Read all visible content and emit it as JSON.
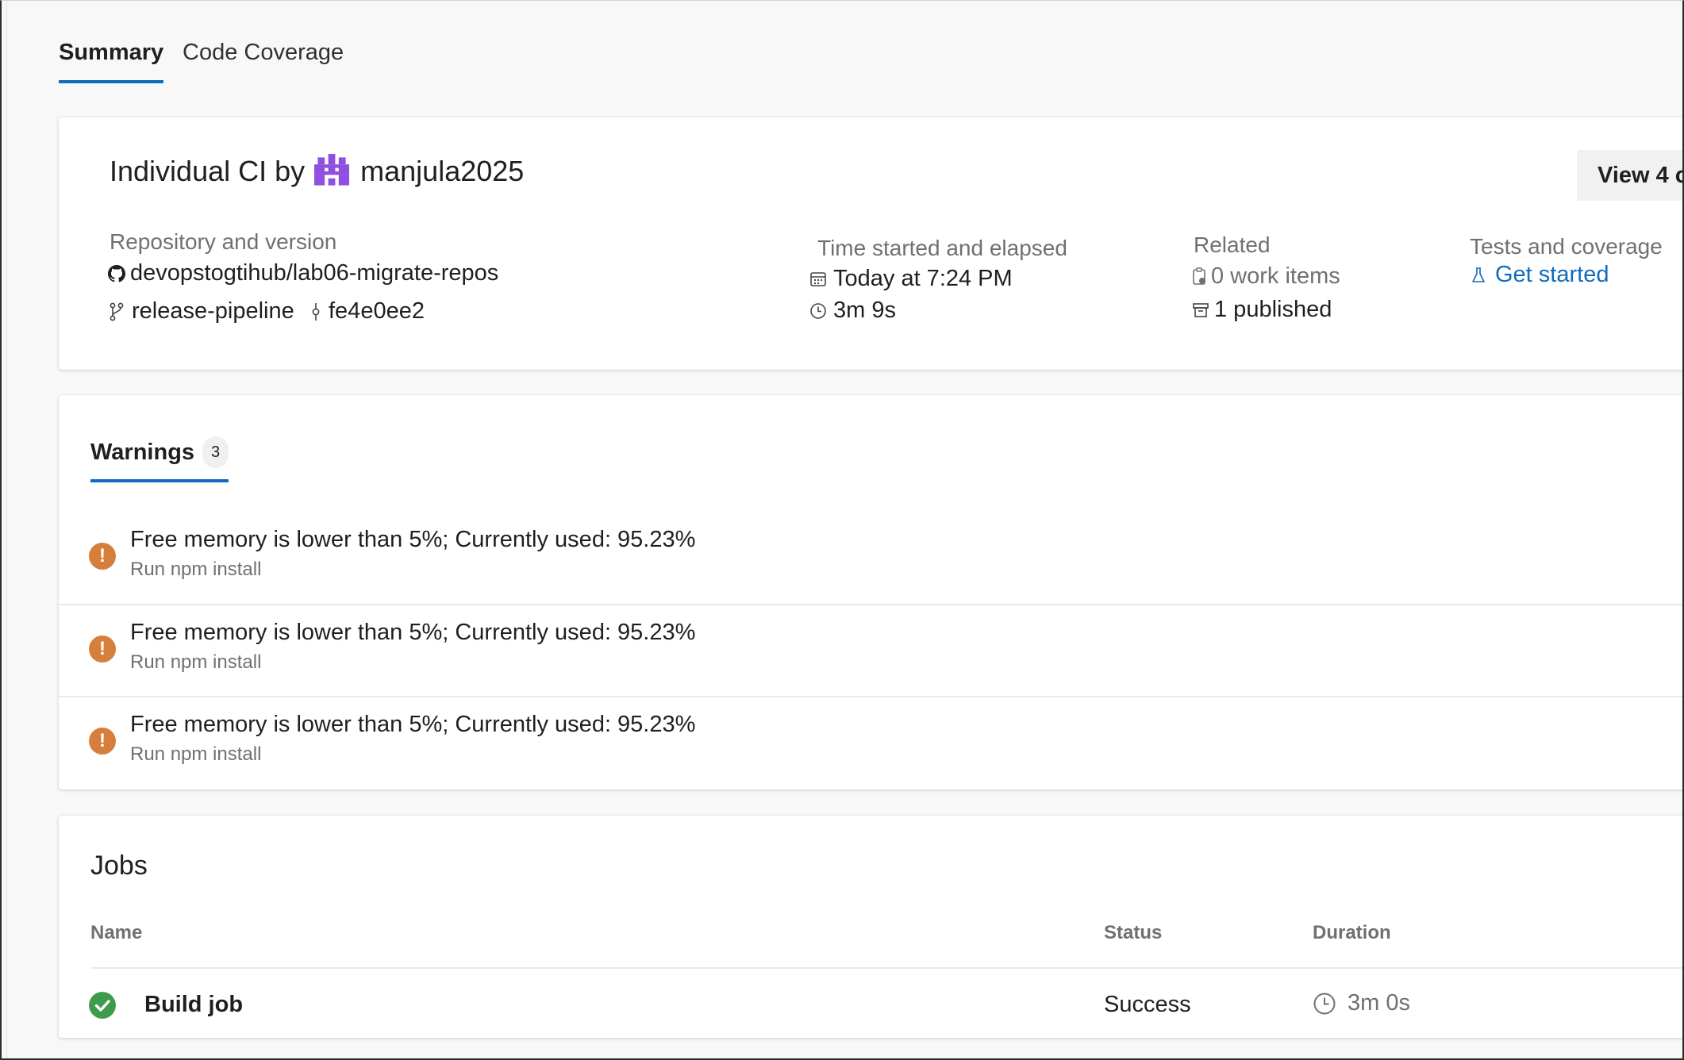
{
  "tabs": [
    {
      "label": "Summary",
      "active": true
    },
    {
      "label": "Code Coverage",
      "active": false
    }
  ],
  "summary": {
    "title_prefix": "Individual CI by",
    "user": "manjula2025",
    "view_button": "View 4 c",
    "repo": {
      "label": "Repository and version",
      "name": "devopstogtihub/lab06-migrate-repos",
      "branch": "release-pipeline",
      "commit": "fe4e0ee2"
    },
    "time": {
      "label": "Time started and elapsed",
      "started": "Today at 7:24 PM",
      "elapsed": "3m 9s"
    },
    "related": {
      "label": "Related",
      "work_items": "0 work items",
      "published": "1 published"
    },
    "tests": {
      "label": "Tests and coverage",
      "link": "Get started"
    }
  },
  "warnings": {
    "tab_label": "Warnings",
    "count": "3",
    "items": [
      {
        "message": "Free memory is lower than 5%; Currently used: 95.23%",
        "source": "Run npm install"
      },
      {
        "message": "Free memory is lower than 5%; Currently used: 95.23%",
        "source": "Run npm install"
      },
      {
        "message": "Free memory is lower than 5%; Currently used: 95.23%",
        "source": "Run npm install"
      }
    ]
  },
  "jobs": {
    "title": "Jobs",
    "columns": {
      "name": "Name",
      "status": "Status",
      "duration": "Duration"
    },
    "rows": [
      {
        "name": "Build job",
        "status": "Success",
        "duration": "3m 0s"
      }
    ]
  },
  "colors": {
    "accent": "#0f6cbd",
    "warning": "#d67f3c",
    "success": "#3e9a4d",
    "avatar": "#8f4fe0"
  }
}
